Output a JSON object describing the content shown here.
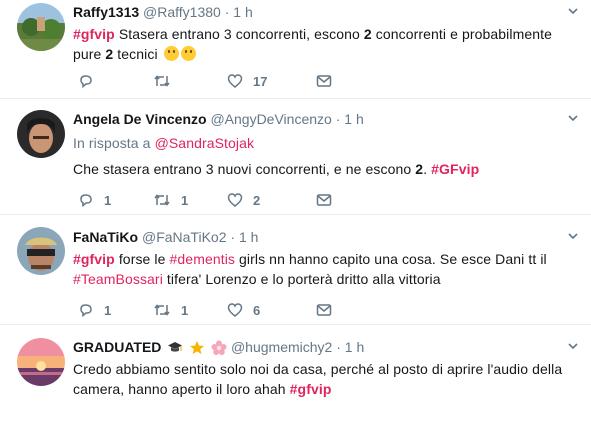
{
  "tweets": [
    {
      "name": "Raffy1313",
      "handle": "@Raffy1380",
      "sep": "·",
      "time": "1 h",
      "text": {
        "hashtag": "#gfvip",
        "t1": " Stasera entrano 3 concorrenti,  escono ",
        "b1": "2",
        "t2": " concorrenti e probabilmente pure ",
        "b2": "2",
        "t3": " tecnici "
      },
      "counts": {
        "reply": "",
        "retweet": "",
        "like": "17"
      }
    },
    {
      "name": "Angela De Vincenzo",
      "handle": "@AngyDeVincenzo",
      "sep": "·",
      "time": "1 h",
      "reply_prefix": "In risposta a ",
      "reply_mention": "@SandraStojak",
      "text": {
        "t1": "Che stasera entrano 3 nuovi concorrenti, e ne escono ",
        "b1": "2",
        "t2": ". ",
        "hashtag": "#GFvip"
      },
      "counts": {
        "reply": "1",
        "retweet": "1",
        "like": "2"
      }
    },
    {
      "name": "FaNaTiKo",
      "handle": "@FaNaTiKo2",
      "sep": "·",
      "time": "1 h",
      "text": {
        "hashtag": "#gfvip",
        "t1": " forse le ",
        "hashtag2": "#dementis",
        "t2": " girls nn hanno capito una cosa. Se esce Dani tt il ",
        "hashtag3": "#TeamBossari",
        "t3": " tifera' Lorenzo e lo porterà dritto alla vittoria"
      },
      "counts": {
        "reply": "1",
        "retweet": "1",
        "like": "6"
      }
    },
    {
      "name": "GRADUATED",
      "handle": "@hugmemichy2",
      "sep": "·",
      "time": "1 h",
      "text": {
        "t1": "Credo abbiamo sentito solo noi da casa, perché al posto di aprire l'audio della camera, hanno aperto il loro ahah ",
        "hashtag": "#gfvip"
      },
      "counts": {
        "reply": "",
        "retweet": "",
        "like": ""
      }
    }
  ],
  "colors": {
    "hashtag": "#e0245e",
    "secondary": "#657786",
    "like": "#657786",
    "border": "#e6ecf0"
  },
  "icons": [
    "reply-icon",
    "retweet-icon",
    "like-icon",
    "message-icon",
    "chevron-down-icon",
    "graduation-cap-icon",
    "star-icon",
    "flower-icon",
    "smiley-emoji"
  ]
}
